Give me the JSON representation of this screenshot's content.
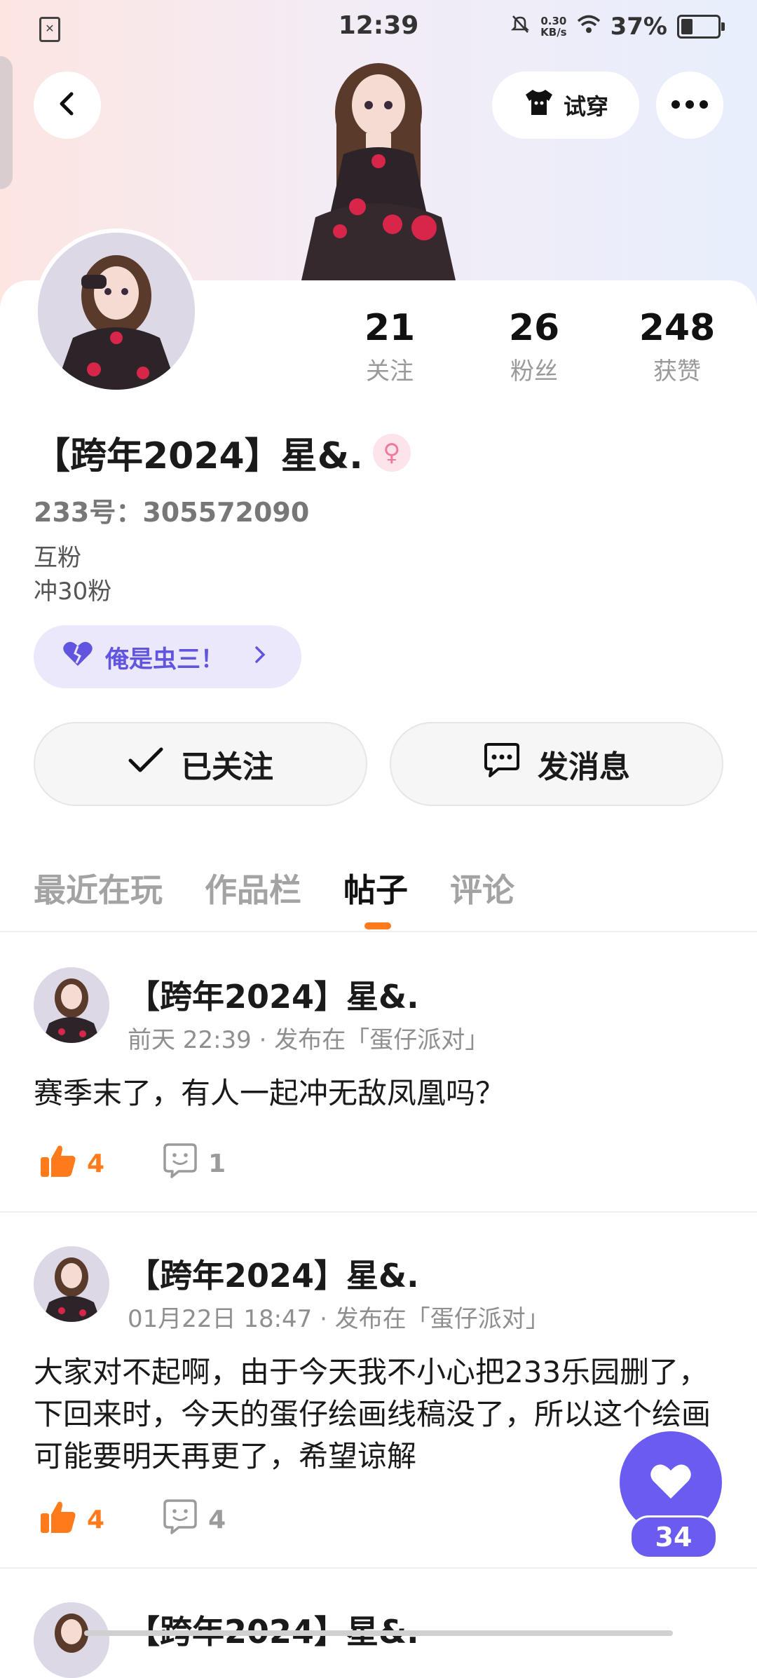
{
  "status_bar": {
    "time": "12:39",
    "speed_value": "0.30",
    "speed_unit": "KB/s",
    "battery": "37%"
  },
  "header": {
    "tryon_label": "试穿"
  },
  "profile": {
    "stats": [
      {
        "value": "21",
        "label": "关注"
      },
      {
        "value": "26",
        "label": "粉丝"
      },
      {
        "value": "248",
        "label": "获赞"
      }
    ],
    "username": "【跨年2024】星&.",
    "uid": "233号：305572090",
    "bio_line1": "互粉",
    "bio_line2": "冲30粉",
    "chip_label": "俺是虫三！",
    "follow_label": "已关注",
    "message_label": "发消息"
  },
  "tabs": [
    {
      "label": "最近在玩",
      "active": false
    },
    {
      "label": "作品栏",
      "active": false
    },
    {
      "label": "帖子",
      "active": true
    },
    {
      "label": "评论",
      "active": false
    }
  ],
  "posts": [
    {
      "author": "【跨年2024】星&.",
      "meta": "前天 22:39 · 发布在「蛋仔派对」",
      "text": "赛季末了，有人一起冲无敌凤凰吗？",
      "likes": "4",
      "comments": "1"
    },
    {
      "author": "【跨年2024】星&.",
      "meta": "01月22日 18:47 · 发布在「蛋仔派对」",
      "text": "大家对不起啊，由于今天我不小心把233乐园删了，下回来时，今天的蛋仔绘画线稿没了，所以这个绘画可能要明天再更了，希望谅解",
      "likes": "4",
      "comments": "4"
    },
    {
      "author": "【跨年2024】星&."
    }
  ],
  "fab": {
    "count": "34"
  },
  "colors": {
    "accent_orange": "#ff7a1a",
    "accent_purple": "#6a5cf0",
    "chip_bg": "#ebe8fc"
  }
}
